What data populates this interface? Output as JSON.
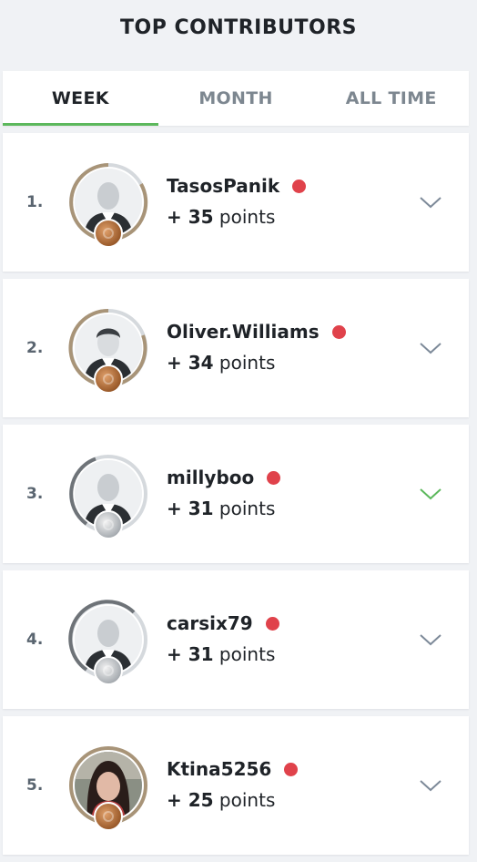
{
  "header": {
    "title": "TOP CONTRIBUTORS"
  },
  "tabs": [
    {
      "label": "WEEK",
      "active": true
    },
    {
      "label": "MONTH",
      "active": false
    },
    {
      "label": "ALL TIME",
      "active": false
    }
  ],
  "colors": {
    "accent": "#5cb85c",
    "status_dot": "#e0424b",
    "chevron": "#7d8a99",
    "chevron_active": "#5cb85c"
  },
  "contributors": [
    {
      "rank": "1.",
      "name": "TasosPanik",
      "prefix": "+ ",
      "points": "35",
      "suffix": " points",
      "medal": "bronze",
      "avatar": "placeholder-avatar"
    },
    {
      "rank": "2.",
      "name": "Oliver.Williams",
      "prefix": "+ ",
      "points": "34",
      "suffix": " points",
      "medal": "bronze",
      "avatar": "male-silhouette-avatar"
    },
    {
      "rank": "3.",
      "name": "millyboo",
      "prefix": "+ ",
      "points": "31",
      "suffix": " points",
      "medal": "silver",
      "avatar": "placeholder-avatar"
    },
    {
      "rank": "4.",
      "name": "carsix79",
      "prefix": "+ ",
      "points": "31",
      "suffix": " points",
      "medal": "silver",
      "avatar": "placeholder-avatar"
    },
    {
      "rank": "5.",
      "name": "Ktina5256",
      "prefix": "+ ",
      "points": "25",
      "suffix": " points",
      "medal": "bronze",
      "avatar": "photo-avatar"
    }
  ]
}
